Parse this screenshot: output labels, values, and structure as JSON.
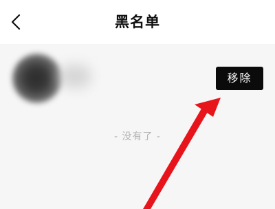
{
  "header": {
    "title": "黑名单",
    "back_icon": "chevron-left-icon"
  },
  "blacklist": {
    "items": [
      {
        "action_label": "移除"
      }
    ],
    "end_text": "- 没有了 -"
  },
  "annotation": {
    "icon": "arrow-icon",
    "color": "#e8141b"
  }
}
